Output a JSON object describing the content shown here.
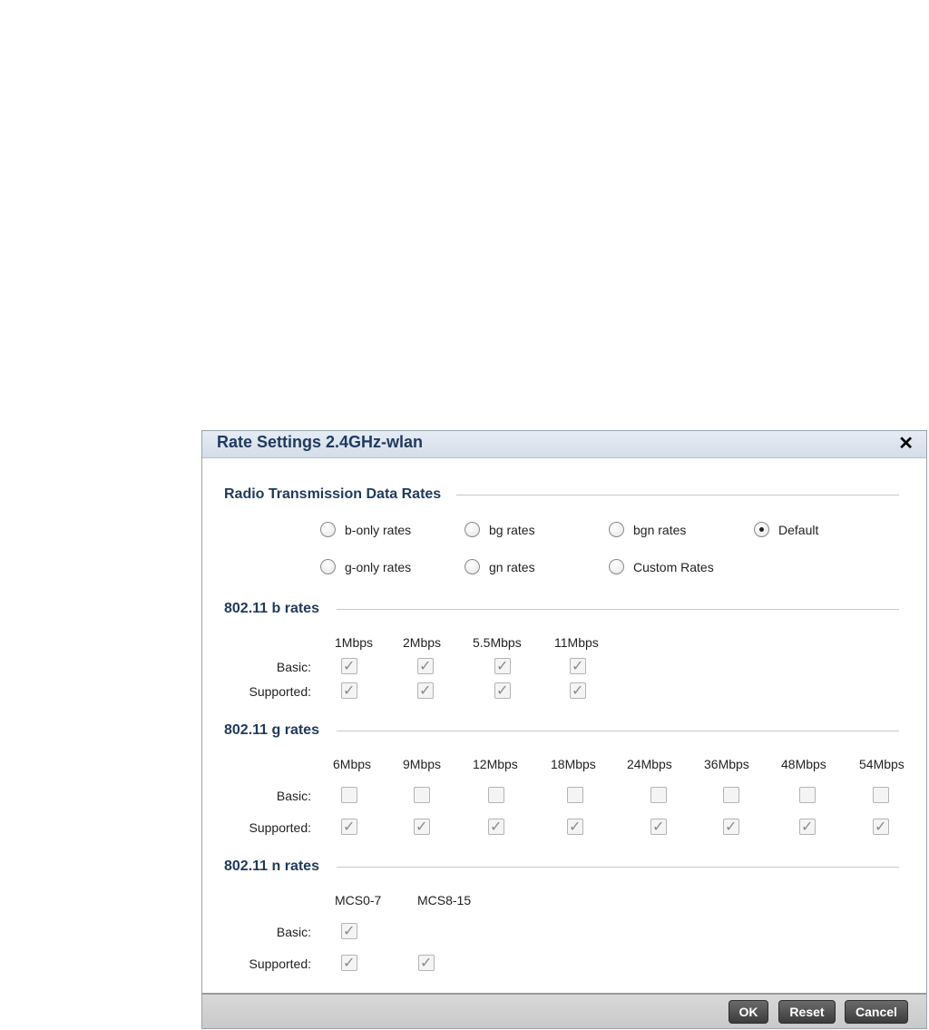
{
  "dialog": {
    "title": "Rate Settings 2.4GHz-wlan",
    "close_glyph": "✕"
  },
  "radio_section": {
    "title": "Radio Transmission Data Rates",
    "options": [
      "b-only rates",
      "bg rates",
      "bgn rates",
      "Default",
      "g-only rates",
      "gn rates",
      "Custom Rates"
    ],
    "selected": "Default"
  },
  "b_rates": {
    "title": "802.11 b rates",
    "columns": [
      "1Mbps",
      "2Mbps",
      "5.5Mbps",
      "11Mbps"
    ],
    "basic_label": "Basic:",
    "supported_label": "Supported:",
    "basic": [
      true,
      true,
      true,
      true
    ],
    "supported": [
      true,
      true,
      true,
      true
    ]
  },
  "g_rates": {
    "title": "802.11 g rates",
    "columns": [
      "6Mbps",
      "9Mbps",
      "12Mbps",
      "18Mbps",
      "24Mbps",
      "36Mbps",
      "48Mbps",
      "54Mbps"
    ],
    "basic_label": "Basic:",
    "supported_label": "Supported:",
    "basic": [
      false,
      false,
      false,
      false,
      false,
      false,
      false,
      false
    ],
    "supported": [
      true,
      true,
      true,
      true,
      true,
      true,
      true,
      true
    ]
  },
  "n_rates": {
    "title": "802.11 n rates",
    "columns": [
      "MCS0-7",
      "MCS8-15"
    ],
    "basic_label": "Basic:",
    "supported_label": "Supported:",
    "basic": [
      true
    ],
    "supported": [
      true,
      true
    ]
  },
  "footer": {
    "ok_label": "OK",
    "reset_label": "Reset",
    "cancel_label": "Cancel"
  }
}
